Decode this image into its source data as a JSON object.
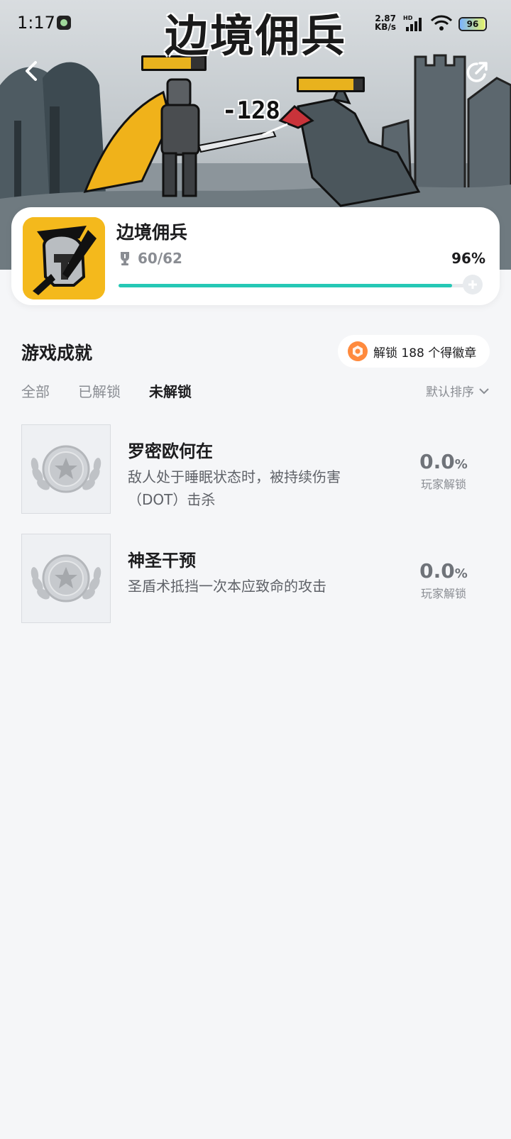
{
  "status_bar": {
    "time": "1:17",
    "net_speed_value": "2.87",
    "net_speed_unit": "KB/s",
    "network_type": "HD",
    "battery": "96"
  },
  "hero": {
    "banner_title": "边境佣兵",
    "damage_text": "-128",
    "hero_hp_fraction": 0.78,
    "enemy_hp_fraction": 0.85
  },
  "game": {
    "name": "边境佣兵",
    "trophies": "60/62",
    "percent": "96%",
    "progress_fraction": 0.96
  },
  "section": {
    "title": "游戏成就",
    "badge_text": "解锁 188 个得徽章"
  },
  "tabs": [
    {
      "label": "全部",
      "active": false
    },
    {
      "label": "已解锁",
      "active": false
    },
    {
      "label": "未解锁",
      "active": true
    }
  ],
  "sort_label": "默认排序",
  "achievements": [
    {
      "name": "罗密欧何在",
      "desc": "敌人处于睡眠状态时，被持续伤害（DOT）击杀",
      "rate": "0.0",
      "rate_unit": "%",
      "rate_label": "玩家解锁"
    },
    {
      "name": "神圣干预",
      "desc": "圣盾术抵挡一次本应致命的攻击",
      "rate": "0.0",
      "rate_unit": "%",
      "rate_label": "玩家解锁"
    }
  ],
  "colors": {
    "accent": "#26c8b5",
    "icon_bg": "#f4b91c",
    "badge": "#ff8a3d"
  }
}
